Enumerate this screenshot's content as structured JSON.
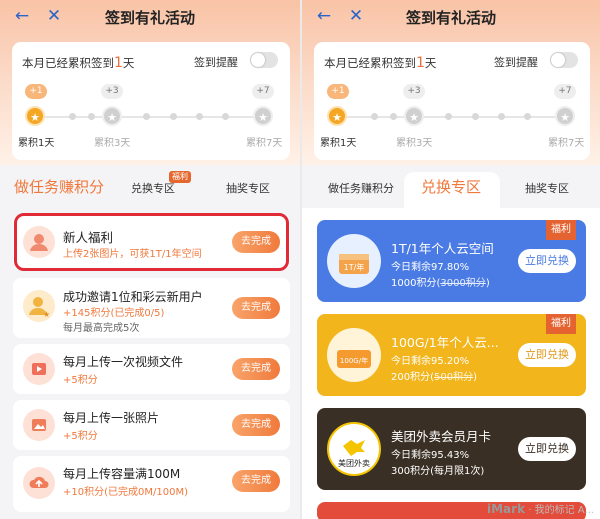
{
  "screens": {
    "left": {
      "nav": {
        "title": "签到有礼活动"
      },
      "sign": {
        "text_prefix": "本月已经累积签到",
        "count": "1",
        "unit": "天",
        "reminder_label": "签到提醒",
        "milestones": [
          {
            "bonus": "+1",
            "label": "累积1天",
            "active": true
          },
          {
            "bonus": "+3",
            "label": "累积3天",
            "active": false
          },
          {
            "bonus": "+7",
            "label": "累积7天",
            "active": false
          }
        ]
      },
      "tabs": {
        "task": "做任务赚积分",
        "exchange": "兑换专区",
        "exchange_badge": "福利",
        "lottery": "抽奖专区"
      },
      "tasks": [
        {
          "title": "新人福利",
          "sub": "上传2张图片，可获1T/1年空间",
          "sub2": "",
          "button": "去完成"
        },
        {
          "title": "成功邀请1位和彩云新用户",
          "sub": "+145积分(已完成0/5)",
          "sub2": "每月最高完成5次",
          "button": "去完成"
        },
        {
          "title": "每月上传一次视频文件",
          "sub": "+5积分",
          "sub2": "",
          "button": "去完成"
        },
        {
          "title": "每月上传一张照片",
          "sub": "+5积分",
          "sub2": "",
          "button": "去完成"
        },
        {
          "title": "每月上传容量满100M",
          "sub": "+10积分(已完成0M/100M)",
          "sub2": "",
          "button": "去完成"
        }
      ]
    },
    "right": {
      "nav": {
        "title": "签到有礼活动"
      },
      "sign": {
        "text_prefix": "本月已经累积签到",
        "count": "1",
        "unit": "天",
        "reminder_label": "签到提醒",
        "milestones": [
          {
            "bonus": "+1",
            "label": "累积1天",
            "active": true
          },
          {
            "bonus": "+3",
            "label": "累积3天",
            "active": false
          },
          {
            "bonus": "+7",
            "label": "累积7天",
            "active": false
          }
        ]
      },
      "tabs": {
        "task": "做任务赚积分",
        "exchange": "兑换专区",
        "lottery": "抽奖专区"
      },
      "prizes": [
        {
          "title": "1T/1年个人云空间",
          "remain": "今日剩余97.80%",
          "points": "1000积分",
          "original": "3000积分",
          "badge": "福利",
          "button": "立即兑换",
          "art_label": "1T/年",
          "color": "#4a7be4"
        },
        {
          "title": "100G/1年个人云...",
          "remain": "今日剩余95.20%",
          "points": "200积分",
          "original": "500积分",
          "badge": "福利",
          "button": "立即兑换",
          "art_label": "100G/年",
          "color": "#f2b51c"
        },
        {
          "title": "美团外卖会员月卡",
          "remain": "今日剩余95.43%",
          "points": "300积分",
          "original": "(每月限1次)",
          "badge": "",
          "button": "立即兑换",
          "art_label": "美团外卖",
          "color": "#3a2f24"
        }
      ],
      "watermark": {
        "brand": "iMark",
        "text": "· 我的标记 A..."
      }
    }
  },
  "colors": {
    "accent": "#f0783c",
    "highlight": "#e02a35",
    "nav_icon": "#2b64c9"
  }
}
